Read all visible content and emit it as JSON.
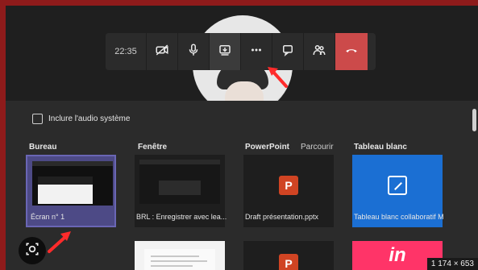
{
  "toolbar": {
    "time": "22:35",
    "buttons": [
      {
        "name": "camera-off-icon"
      },
      {
        "name": "microphone-icon"
      },
      {
        "name": "share-tray-icon"
      },
      {
        "name": "more-options-icon"
      },
      {
        "name": "chat-icon"
      },
      {
        "name": "participants-icon"
      },
      {
        "name": "hang-up-icon"
      }
    ]
  },
  "share_panel": {
    "include_audio_label": "Inclure l'audio système",
    "headings": {
      "bureau": "Bureau",
      "fenetre": "Fenêtre",
      "powerpoint": "PowerPoint",
      "parcourir": "Parcourir",
      "tableau_blanc": "Tableau blanc"
    },
    "tiles": {
      "screen_caption": "Écran n° 1",
      "window_caption": "BRL : Enregistrer avec  lea...",
      "powerpoint_caption": "Draft présentation.pptx",
      "whiteboard_caption": "Tableau blanc collaboratif M"
    }
  },
  "overlay": {
    "dimensions": "1 174 × 653"
  },
  "colors": {
    "frame_border": "#8e1b1b",
    "accent_selected": "#4d4a86",
    "whiteboard_blue": "#1b6fd3",
    "end_call_red": "#cc4a4a",
    "powerpoint_orange": "#d04423",
    "invision_pink": "#ff3468"
  }
}
